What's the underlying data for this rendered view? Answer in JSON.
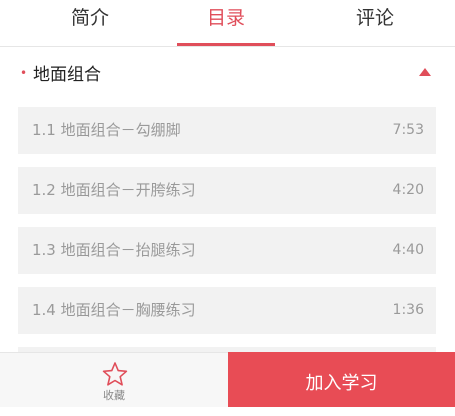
{
  "tabs": [
    {
      "label": "简介"
    },
    {
      "label": "目录"
    },
    {
      "label": "评论"
    }
  ],
  "section": {
    "title": "地面组合",
    "lessons": [
      {
        "title": "1.1 地面组合－勾绷脚",
        "duration": "7:53"
      },
      {
        "title": "1.2 地面组合－开胯练习",
        "duration": "4:20"
      },
      {
        "title": "1.3 地面组合－抬腿练习",
        "duration": "4:40"
      },
      {
        "title": "1.4 地面组合－胸腰练习",
        "duration": "1:36"
      }
    ]
  },
  "bottom": {
    "favorite_label": "收藏",
    "join_label": "加入学习"
  },
  "colors": {
    "accent": "#e04e5a",
    "join_button": "#e84c55"
  }
}
